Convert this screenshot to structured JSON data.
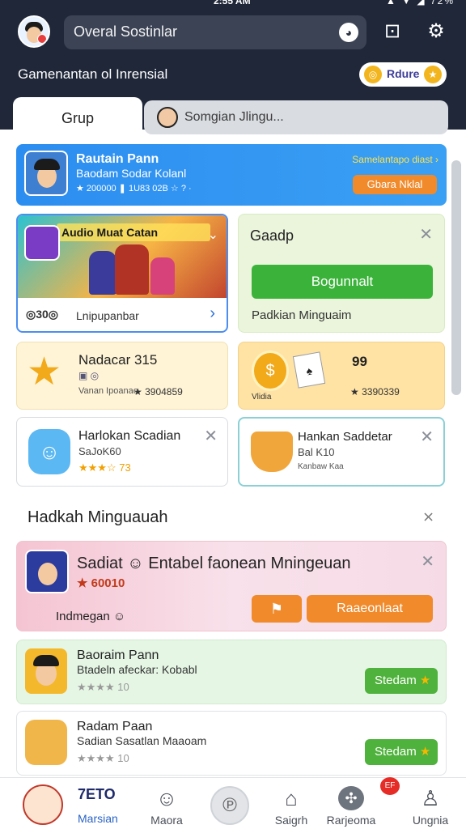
{
  "status": {
    "time": "2:55 AM",
    "icons": "▲ ▼ ◢ 72%"
  },
  "header": {
    "search_text": "Overal Sostinlar",
    "subtitle": "Gamenantan ol Inrensial",
    "coin_label": "Rdure"
  },
  "tabs": [
    {
      "label": "Grup"
    },
    {
      "label": "Somgian Jlingu..."
    }
  ],
  "promo_blue": {
    "title": "Rautain Pann",
    "subtitle": "Baodam Sodar Kolanl",
    "meta": "★ 200000 ❚ 1U83 02B ☆ ? ·",
    "link": "Samelantapo diast ›",
    "button": "Gbara Nklal"
  },
  "game_card": {
    "banner_title": "Audio Muat Catan",
    "coins": "30",
    "label": "Lnipupanbar",
    "arrow": "›"
  },
  "green_card": {
    "title": "Gaadp",
    "button": "Bogunnalt",
    "footer": "Padkian Minguaim"
  },
  "yellow_left": {
    "title": "Nadacar 315",
    "sub": "▣ ◎",
    "meta": "Vanan Ipoanao",
    "value": "★ 3904859"
  },
  "yellow_right": {
    "title": "99",
    "meta": "Vlidia",
    "value": "★ 3390339"
  },
  "white_left": {
    "title": "Harlokan Scadian",
    "sub": "SaJoK60",
    "rating": "★★★☆ 73"
  },
  "white_right": {
    "title": "Hankan Saddetar",
    "sub": "Bal K10",
    "meta": "Kanbaw Kaa"
  },
  "section": {
    "title": "Hadkah Minguauah",
    "icon": "⨯"
  },
  "pink": {
    "title": "Sadiat ☺ Entabel faonean Mningeuan",
    "subtitle": "★ 60010",
    "footer": "Indmegan ☺",
    "button": "Raaeonlaat"
  },
  "list": [
    {
      "title": "Baoraim Pann",
      "sub": "Btadeln afeckar: Kobabl",
      "rating": "★★★★ 10",
      "button": "Stedam"
    },
    {
      "title": "Radam Paan",
      "sub": "Sadian Sasatlan Maaoam",
      "rating": "★★★★ 10",
      "button": "Stedam"
    }
  ],
  "nav": [
    {
      "label": "Marsian",
      "icon": "avatar"
    },
    {
      "label": "Maora",
      "icon": "smile-icon"
    },
    {
      "label": "",
      "icon": "home-icon"
    },
    {
      "label": "Saigrh",
      "icon": "lock-icon"
    },
    {
      "label": "Rarjeoma",
      "icon": "globe-icon"
    },
    {
      "label": "Ungnia",
      "icon": "user-icon"
    }
  ],
  "nav_badge": "EF",
  "nav_avatar_number": "7ETO",
  "colors": {
    "header": "#1f2739",
    "accent_blue": "#2c8df0",
    "accent_green": "#3bb33b",
    "accent_orange": "#f08a2b"
  }
}
